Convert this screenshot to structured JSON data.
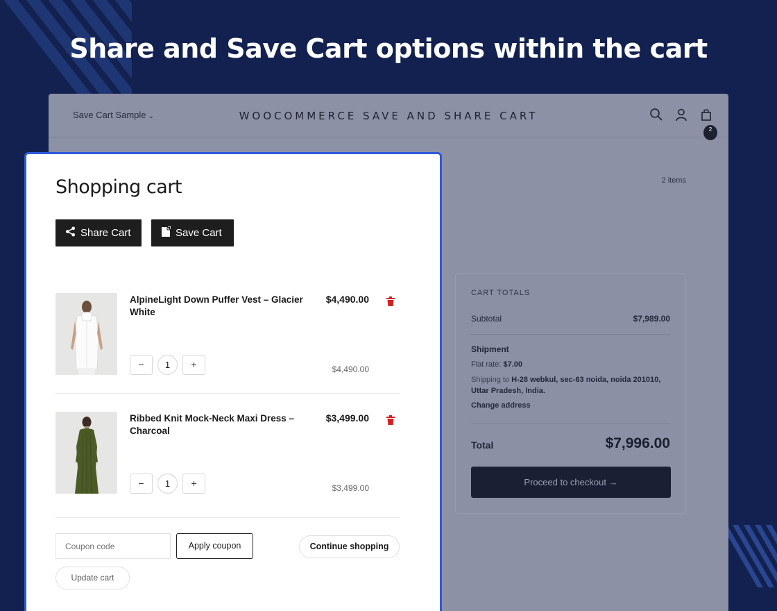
{
  "headline": "Share and Save Cart options within the cart",
  "store": {
    "menu_label": "Save Cart Sample",
    "title": "WOOCOMMERCE SAVE AND SHARE CART",
    "cart_badge": "2",
    "items_count": "2 items"
  },
  "totals": {
    "heading": "CART TOTALS",
    "subtotal_label": "Subtotal",
    "subtotal_value": "$7,989.00",
    "shipment_label": "Shipment",
    "flat_rate_label": "Flat rate:",
    "flat_rate_value": "$7.00",
    "shipping_prefix": "Shipping to",
    "shipping_address": "H-28 webkul, sec-63 noida, noida 201010, Uttar Pradesh, India.",
    "change_address": "Change address",
    "total_label": "Total",
    "total_value": "$7,996.00",
    "checkout_label": "Proceed to checkout →"
  },
  "cart": {
    "title": "Shopping cart",
    "share_label": "Share Cart",
    "save_label": "Save Cart",
    "items": [
      {
        "name": "AlpineLight Down Puffer Vest – Glacier White",
        "price": "$4,490.00",
        "quantity": "1",
        "subtotal": "$4,490.00"
      },
      {
        "name": "Ribbed Knit Mock-Neck Maxi Dress – Charcoal",
        "price": "$3,499.00",
        "quantity": "1",
        "subtotal": "$3,499.00"
      }
    ],
    "coupon_placeholder": "Coupon code",
    "apply_label": "Apply coupon",
    "continue_label": "Continue shopping",
    "update_label": "Update cart"
  },
  "colors": {
    "background": "#12214f",
    "panel_border": "#2e5bdb",
    "dark_button": "#1e1e1e",
    "trash": "#d32020"
  },
  "icons": [
    "share-icon",
    "save-icon",
    "search-icon",
    "user-icon",
    "bag-icon",
    "trash-icon",
    "minus-icon",
    "plus-icon",
    "chevron-down-icon",
    "arrow-right-icon"
  ]
}
